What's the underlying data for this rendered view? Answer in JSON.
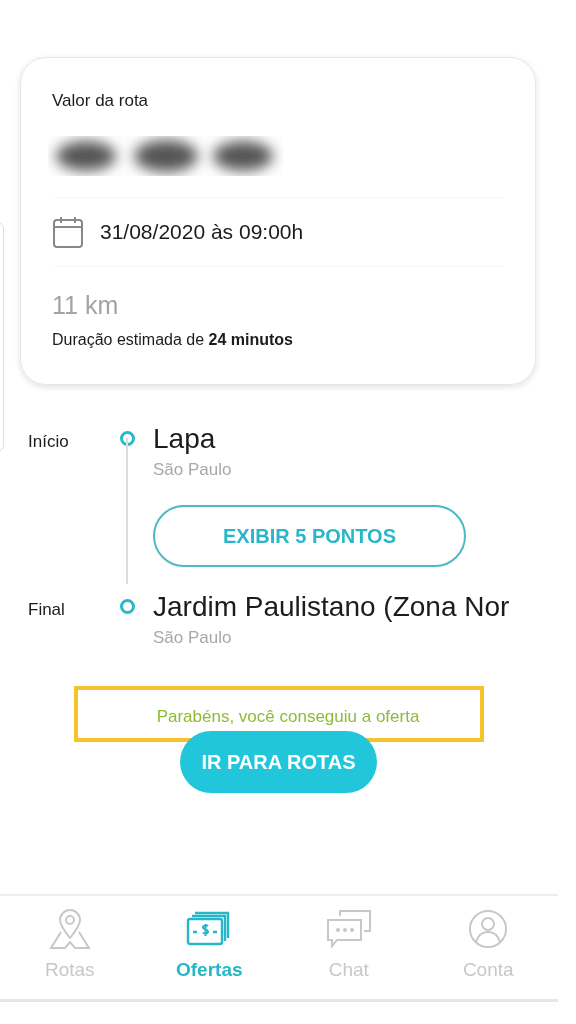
{
  "route_card": {
    "value_label": "Valor da rota",
    "date": "31/08/2020 às 09:00h",
    "distance": "11 km",
    "duration": "Duração estimada de **24 minutos**"
  },
  "stops": [
    {
      "label": "Início",
      "place": "Lapa",
      "city": "São Paulo"
    },
    {
      "label": "Final",
      "place": "Jardim Paulistano (Zona Nor",
      "city": "São Paulo"
    }
  ],
  "show_points_button": "EXIBIR 5 PONTOS",
  "success_message": "Parabéns, você conseguiu a oferta",
  "go_button": "IR PARA ROTAS",
  "nav": [
    {
      "label": "Rotas",
      "kind": "routes",
      "selected": false
    },
    {
      "label": "Ofertas",
      "kind": "offers",
      "selected": true
    },
    {
      "label": "Chat",
      "kind": "chat",
      "selected": false
    },
    {
      "label": "Conta",
      "kind": "account",
      "selected": false
    }
  ]
}
